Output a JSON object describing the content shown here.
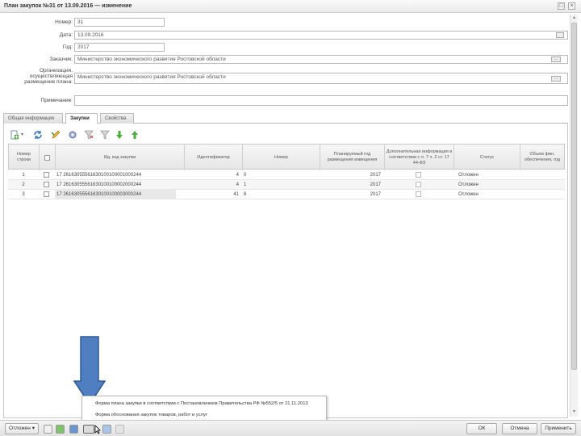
{
  "window": {
    "title": "План закупок №31 от 13.09.2016 — изменение",
    "restore_glyph": "□",
    "close_glyph": "×"
  },
  "form": {
    "fields": [
      {
        "label": "Номер:",
        "value": "31"
      },
      {
        "label": "Дата:",
        "value": "13.09.2016"
      },
      {
        "label": "Год:",
        "value": "2017"
      },
      {
        "label": "Заказчик:",
        "value": "Министерство экономического развития Ростовской области"
      },
      {
        "label": "Организация, осуществляющая размещение плана:",
        "value": "Министерство экономического развития Ростовской области"
      },
      {
        "label": "Примечание:",
        "value": ""
      }
    ],
    "lookup_glyph": "..."
  },
  "tabs": [
    {
      "label": "Общая информация",
      "active": false
    },
    {
      "label": "Закупки",
      "active": true
    },
    {
      "label": "Свойства",
      "active": false
    }
  ],
  "toolbar": {
    "icons": [
      "add-icon",
      "refresh-icon",
      "edit-icon",
      "settings-icon",
      "filter-icon",
      "filter-clear-icon",
      "move-down-icon",
      "move-up-icon"
    ]
  },
  "grid": {
    "columns": [
      "Номер строки",
      "",
      "Ид. код закупки",
      "Идентификатор",
      "Номер",
      "Планируемый год размещения извещения",
      "Дополнительная информация в соответствии с п. 7 ч. 2 ст. 17 44-ФЗ",
      "Статус",
      "Объем фин. обеспечения, год"
    ],
    "rows": [
      {
        "num": "1",
        "code": "17 26163055561630100100001000244",
        "id": "4",
        "number": "0",
        "year": "2017",
        "status": "Отложен"
      },
      {
        "num": "2",
        "code": "17 26163055561630100100002000244",
        "id": "4",
        "number": "1",
        "year": "2017",
        "status": "Отложен"
      },
      {
        "num": "3",
        "code": "17 26163055561630100100003000244",
        "id": "41",
        "number": "6",
        "year": "2017",
        "status": "Отложен"
      }
    ]
  },
  "popup": {
    "items": [
      "Форма плана закупки в соответствии с Постановлением Правительства РФ №552/5 от 21.11.2013",
      "Форма обоснования закупок товаров, работ и услуг"
    ]
  },
  "bottom": {
    "deferred_label": "Отложен",
    "ok_label": "ОК",
    "cancel_label": "Отмена",
    "apply_label": "Применить"
  },
  "colors": {
    "arrow_fill": "#4f7fc0",
    "arrow_stroke": "#2e5896"
  }
}
